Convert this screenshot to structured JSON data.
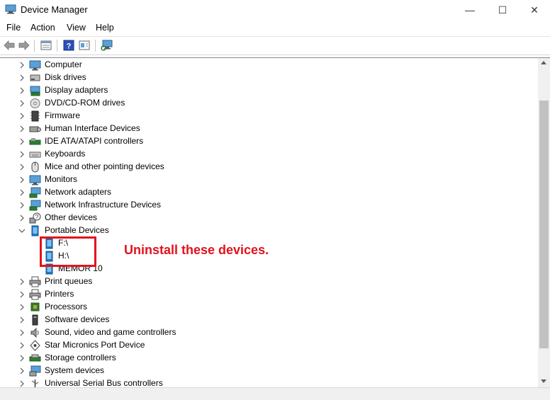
{
  "window": {
    "title": "Device Manager",
    "minimize_glyph": "—",
    "maximize_glyph": "☐",
    "close_glyph": "✕"
  },
  "menu": {
    "file": "File",
    "action": "Action",
    "view": "View",
    "help": "Help"
  },
  "toolbar": {
    "icons": [
      "back-icon",
      "forward-icon",
      "properties-icon",
      "help-icon",
      "update-driver-icon",
      "scan-hardware-icon"
    ]
  },
  "tree": {
    "items": [
      {
        "label": "Computer",
        "icon": "computer-icon",
        "expanded": false
      },
      {
        "label": "Disk drives",
        "icon": "disk-drive-icon",
        "expanded": false
      },
      {
        "label": "Display adapters",
        "icon": "display-adapter-icon",
        "expanded": false
      },
      {
        "label": "DVD/CD-ROM drives",
        "icon": "dvd-drive-icon",
        "expanded": false
      },
      {
        "label": "Firmware",
        "icon": "firmware-icon",
        "expanded": false
      },
      {
        "label": "Human Interface Devices",
        "icon": "hid-icon",
        "expanded": false
      },
      {
        "label": "IDE ATA/ATAPI controllers",
        "icon": "ide-controller-icon",
        "expanded": false
      },
      {
        "label": "Keyboards",
        "icon": "keyboard-icon",
        "expanded": false
      },
      {
        "label": "Mice and other pointing devices",
        "icon": "mouse-icon",
        "expanded": false
      },
      {
        "label": "Monitors",
        "icon": "monitor-icon",
        "expanded": false
      },
      {
        "label": "Network adapters",
        "icon": "network-adapter-icon",
        "expanded": false
      },
      {
        "label": "Network Infrastructure Devices",
        "icon": "network-infrastructure-icon",
        "expanded": false
      },
      {
        "label": "Other devices",
        "icon": "unknown-device-icon",
        "expanded": false
      },
      {
        "label": "Portable Devices",
        "icon": "portable-device-icon",
        "expanded": true
      },
      {
        "label": "F:\\",
        "icon": "portable-device-icon",
        "child": true
      },
      {
        "label": "H:\\",
        "icon": "portable-device-icon",
        "child": true
      },
      {
        "label": "MEMOR 10",
        "icon": "portable-device-icon",
        "child": true
      },
      {
        "label": "Print queues",
        "icon": "print-queue-icon",
        "expanded": false
      },
      {
        "label": "Printers",
        "icon": "printer-icon",
        "expanded": false
      },
      {
        "label": "Processors",
        "icon": "processor-icon",
        "expanded": false
      },
      {
        "label": "Software devices",
        "icon": "software-device-icon",
        "expanded": false
      },
      {
        "label": "Sound, video and game controllers",
        "icon": "sound-icon",
        "expanded": false
      },
      {
        "label": "Star Micronics Port Device",
        "icon": "port-device-icon",
        "expanded": false
      },
      {
        "label": "Storage controllers",
        "icon": "storage-controller-icon",
        "expanded": false
      },
      {
        "label": "System devices",
        "icon": "system-device-icon",
        "expanded": false
      },
      {
        "label": "Universal Serial Bus controllers",
        "icon": "usb-controller-icon",
        "expanded": false
      }
    ]
  },
  "annotation": {
    "text": "Uninstall these devices.",
    "color": "#e2121b"
  },
  "colors": {
    "accent_red": "#e2121b",
    "icon_blue": "#1f78c8"
  }
}
